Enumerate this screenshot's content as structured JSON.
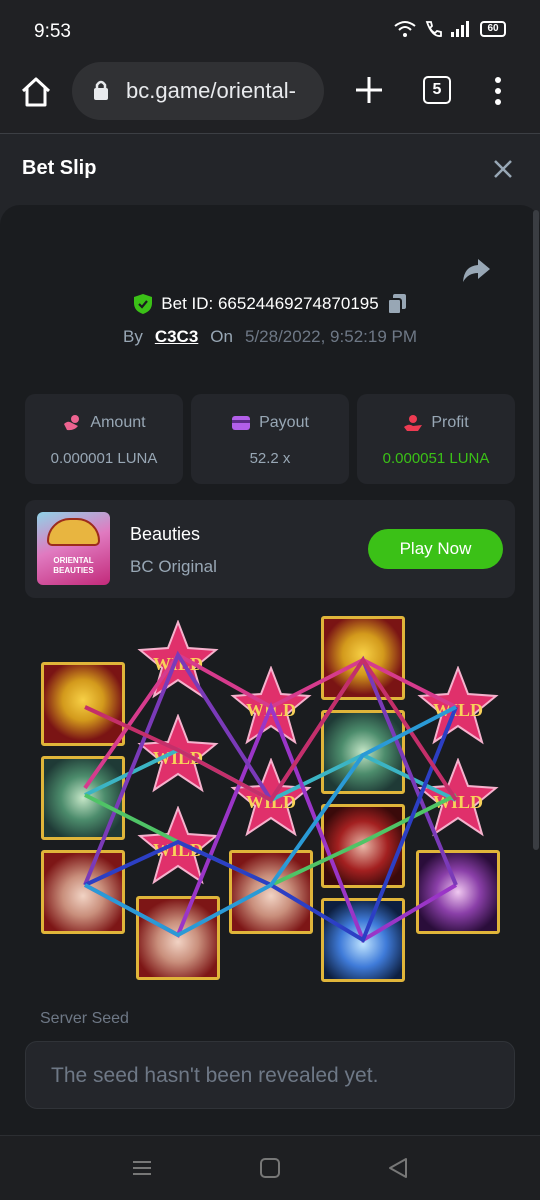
{
  "status": {
    "time": "9:53",
    "battery": "60"
  },
  "browser": {
    "url": "bc.game/oriental-",
    "tab_count": "5"
  },
  "slip": {
    "title": "Bet Slip"
  },
  "bet": {
    "id_label": "Bet ID: 66524469274870195",
    "by_label": "By",
    "user": "C3C3",
    "on_label": "On",
    "date": "5/28/2022, 9:52:19 PM"
  },
  "stats": [
    {
      "label": "Amount",
      "value": "0.000001 LUNA",
      "icon": "amount-icon",
      "color": "#ed6390"
    },
    {
      "label": "Payout",
      "value": "52.2 x",
      "icon": "wallet-icon",
      "color": "#b25fe9"
    },
    {
      "label": "Profit",
      "value": "0.000051 LUNA",
      "icon": "profit-icon",
      "color": "#ed3b52"
    }
  ],
  "game": {
    "name": "Beauties",
    "provider": "BC Original",
    "thumb_text": "ORIENTAL BEAUTIES",
    "play_label": "Play Now"
  },
  "reels": {
    "symbols": [
      "gold",
      "wild",
      "wild",
      "gold",
      "wild",
      "jade",
      "wild",
      "wild",
      "jade",
      "wild",
      "wild",
      "beauty",
      "wild",
      "beauty",
      "beauty",
      "beauty",
      "lotus",
      "orb"
    ],
    "wild_text": "WILD"
  },
  "seed": {
    "label": "Server Seed",
    "value": "The seed hasn't been revealed yet."
  },
  "colors": {
    "accent_green": "#3bc117",
    "frame_gold": "#e0b53a",
    "bg": "#1a1c1f"
  }
}
